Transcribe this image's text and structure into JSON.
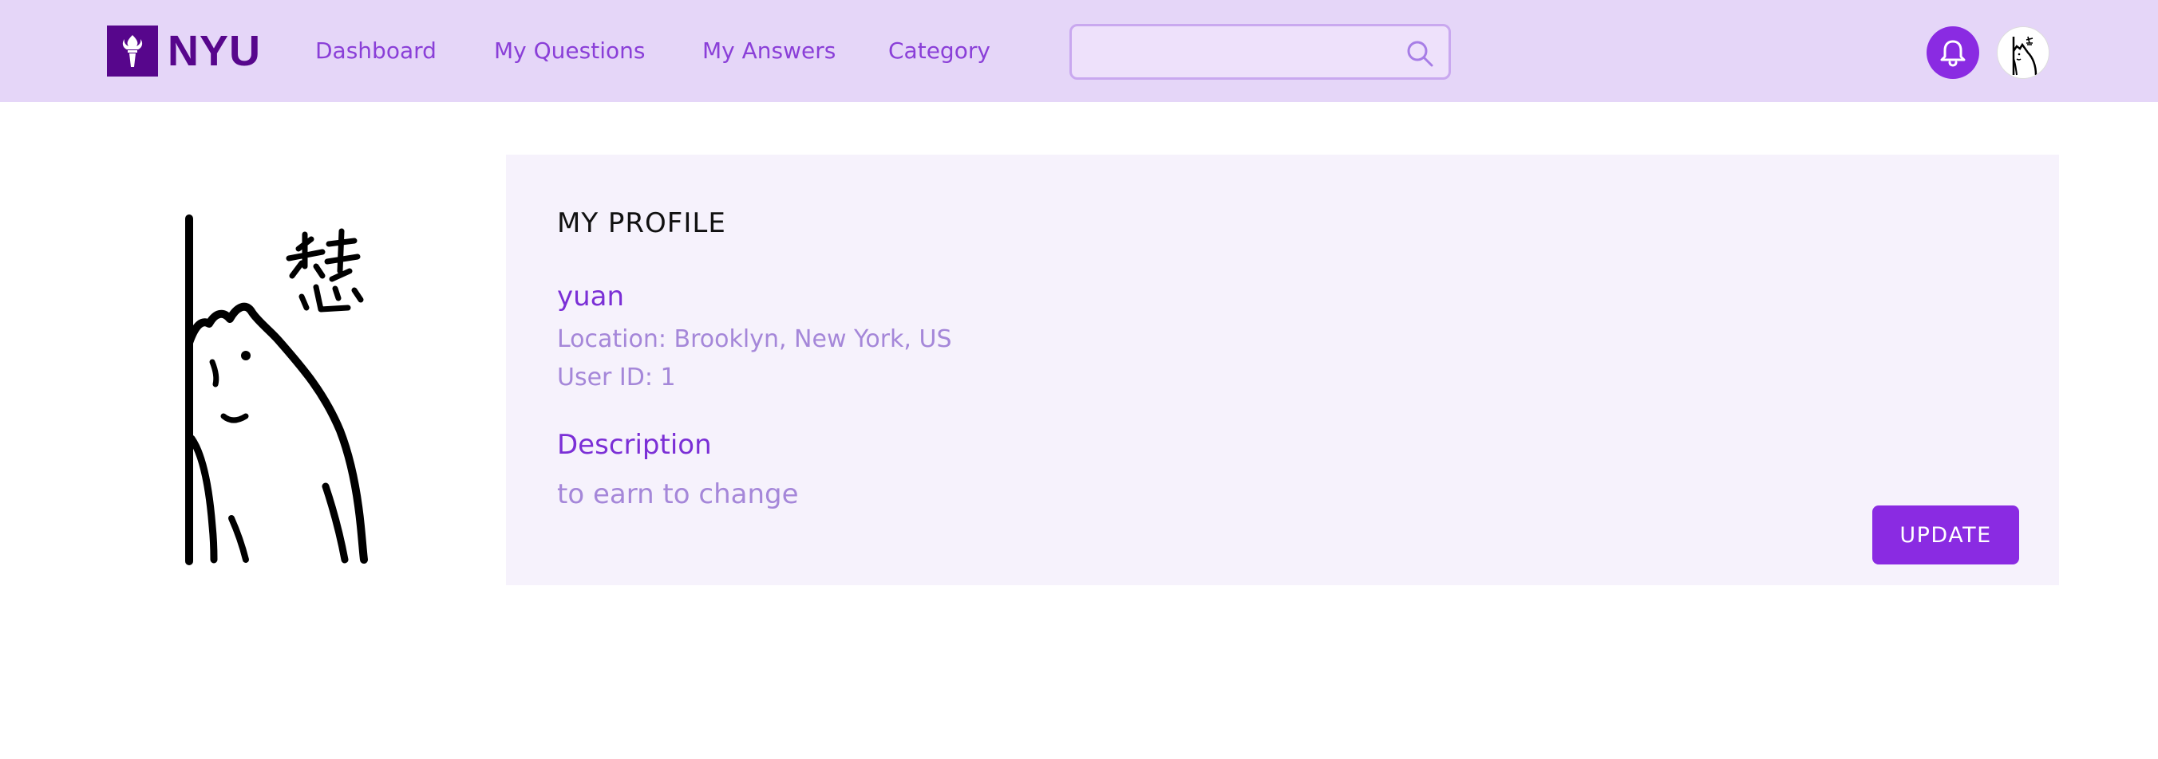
{
  "header": {
    "logo_text": "NYU",
    "nav": [
      {
        "label": "Dashboard"
      },
      {
        "label": "My Questions"
      },
      {
        "label": "My Answers"
      },
      {
        "label": "Category"
      }
    ],
    "search": {
      "placeholder": "",
      "value": "",
      "icon": "search-icon"
    },
    "notification_icon": "bell-icon",
    "avatar_icon": "cat-avatar"
  },
  "profile": {
    "title": "MY PROFILE",
    "username": "yuan",
    "location": "Location: Brooklyn, New York, US",
    "user_id": "User ID: 1",
    "description_heading": "Description",
    "description": "to earn to change",
    "update_label": "UPDATE"
  },
  "colors": {
    "header_bg": "#e5d6f8",
    "brand": "#57068c",
    "accent": "#8a2be2",
    "link": "#8a3fd8",
    "muted": "#a587d9",
    "card_bg": "#f6f2fc"
  }
}
